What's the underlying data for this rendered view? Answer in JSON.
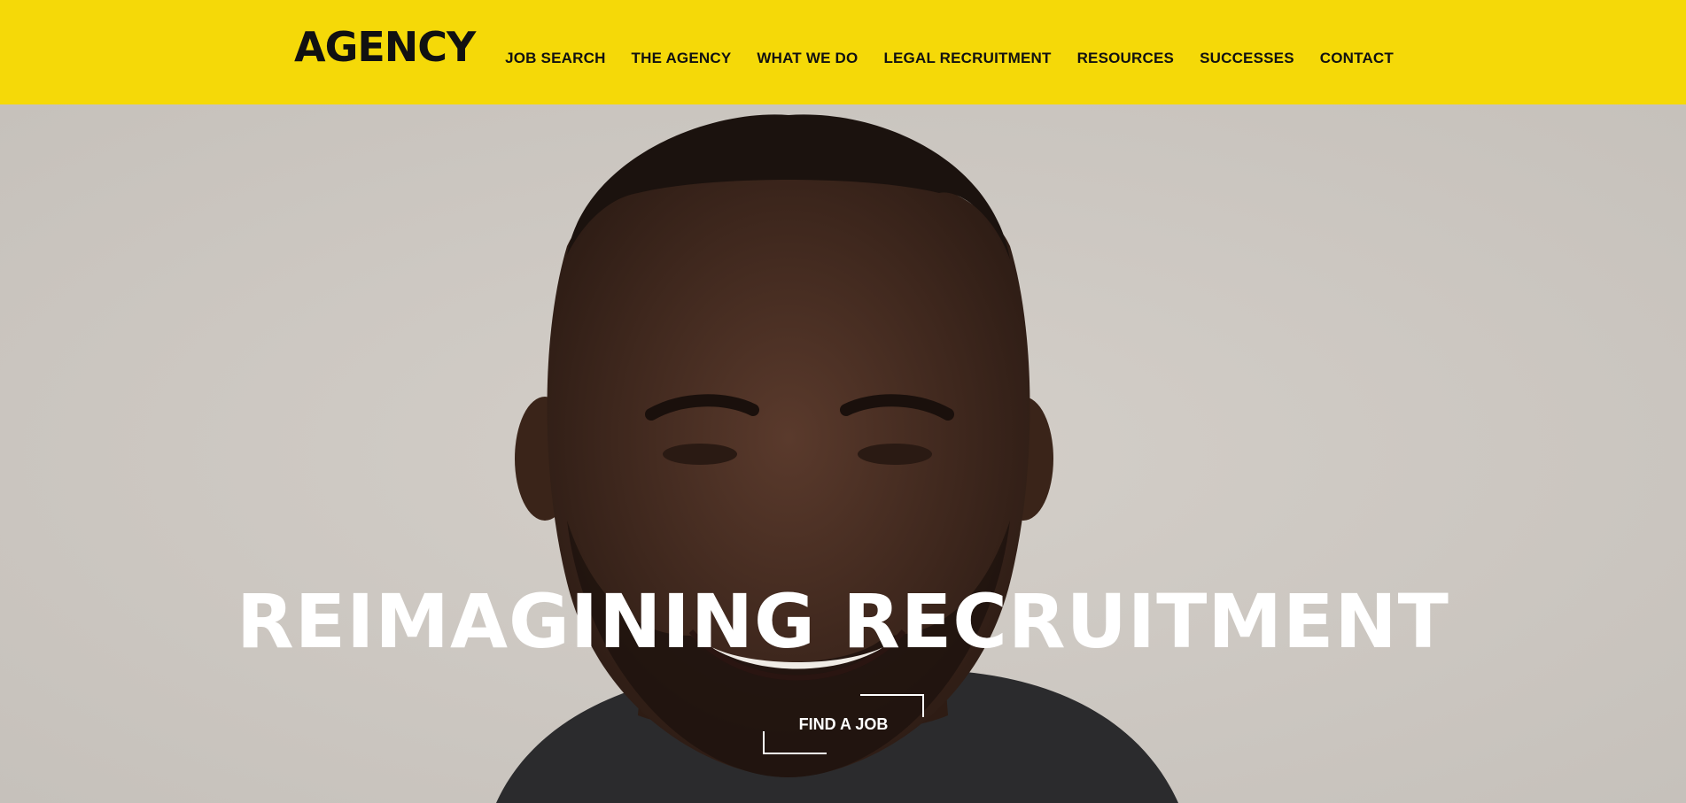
{
  "header": {
    "logo_text": "AGENCY",
    "nav": [
      {
        "label": "JOB SEARCH"
      },
      {
        "label": "THE AGENCY"
      },
      {
        "label": "WHAT WE DO"
      },
      {
        "label": "LEGAL RECRUITMENT"
      },
      {
        "label": "RESOURCES"
      },
      {
        "label": "SUCCESSES"
      },
      {
        "label": "CONTACT"
      }
    ]
  },
  "hero": {
    "headline": "REIMAGINING RECRUITMENT",
    "cta_label": "FIND A JOB",
    "image": "smiling-man-portrait"
  },
  "colors": {
    "brand_yellow": "#f5d908",
    "text_dark": "#111111",
    "hero_text": "#ffffff"
  }
}
